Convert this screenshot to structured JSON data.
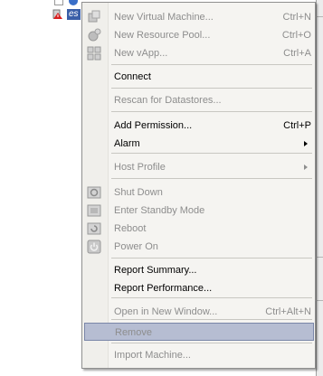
{
  "tree": {
    "partial_label": "...",
    "host_label": "es"
  },
  "menu": {
    "items": [
      {
        "label": "New Virtual Machine...",
        "shortcut": "Ctrl+N",
        "icon": "new-vm-icon",
        "disabled": true
      },
      {
        "label": "New Resource Pool...",
        "shortcut": "Ctrl+O",
        "icon": "resource-pool-icon",
        "disabled": true
      },
      {
        "label": "New vApp...",
        "shortcut": "Ctrl+A",
        "icon": "vapp-icon",
        "disabled": true
      },
      {
        "label": "Connect",
        "shortcut": "",
        "icon": "",
        "disabled": false
      },
      {
        "label": "Rescan for Datastores...",
        "shortcut": "",
        "icon": "",
        "disabled": true
      },
      {
        "label": "Add Permission...",
        "shortcut": "Ctrl+P",
        "icon": "",
        "disabled": false
      },
      {
        "label": "Alarm",
        "shortcut": "",
        "icon": "",
        "disabled": false,
        "submenu": true
      },
      {
        "label": "Host Profile",
        "shortcut": "",
        "icon": "",
        "disabled": true,
        "submenu": true
      },
      {
        "label": "Shut Down",
        "shortcut": "",
        "icon": "shutdown-icon",
        "disabled": true
      },
      {
        "label": "Enter Standby Mode",
        "shortcut": "",
        "icon": "standby-icon",
        "disabled": true
      },
      {
        "label": "Reboot",
        "shortcut": "",
        "icon": "reboot-icon",
        "disabled": true
      },
      {
        "label": "Power On",
        "shortcut": "",
        "icon": "power-on-icon",
        "disabled": true
      },
      {
        "label": "Report Summary...",
        "shortcut": "",
        "icon": "",
        "disabled": false
      },
      {
        "label": "Report Performance...",
        "shortcut": "",
        "icon": "",
        "disabled": false
      },
      {
        "label": "Open in New Window...",
        "shortcut": "Ctrl+Alt+N",
        "icon": "",
        "disabled": true
      },
      {
        "label": "Remove",
        "shortcut": "",
        "icon": "",
        "disabled": true,
        "selected": true
      },
      {
        "label": "Import Machine...",
        "shortcut": "",
        "icon": "",
        "disabled": true
      }
    ]
  }
}
